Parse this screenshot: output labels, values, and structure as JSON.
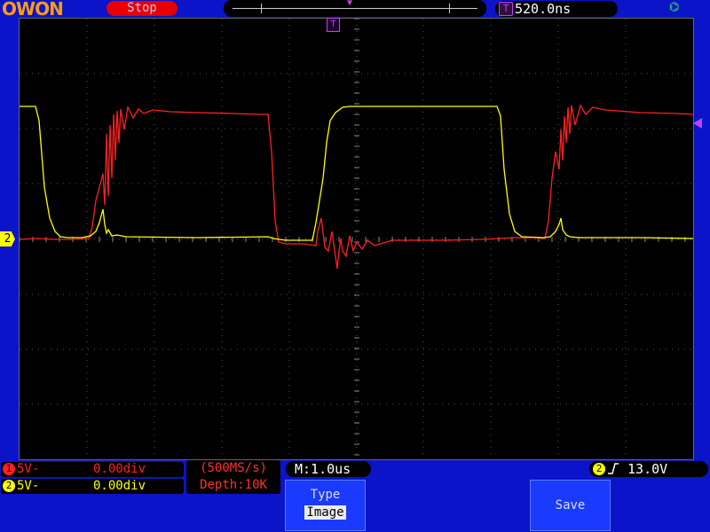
{
  "brand": "OWON",
  "run_state": "Stop",
  "trigger_position": "520.0ns",
  "trigger_badge": "T",
  "trigger_marker": "T",
  "channel2_marker": "2",
  "channel1": {
    "number": "1",
    "volts_per_div": "5V-",
    "offset": "0.00div",
    "color": "#ff2020"
  },
  "channel2": {
    "number": "2",
    "volts_per_div": "5V-",
    "offset": "0.00div",
    "color": "#ffff00"
  },
  "acquisition": {
    "sample_rate": "(500MS/s)",
    "depth": "Depth:10K"
  },
  "main_timebase": "M:1.0us",
  "trigger": {
    "source": "2",
    "level": "13.0V",
    "edge": "rising-edge-icon"
  },
  "menu": {
    "type_label": "Type",
    "type_value": "Image",
    "save_label": "Save"
  },
  "icons": {
    "usb": "usb-icon"
  },
  "colors": {
    "background": "#0b14c8",
    "screen": "#000000",
    "ch1": "#ff2020",
    "ch2": "#ffff00",
    "trigger": "#c040ff"
  }
}
